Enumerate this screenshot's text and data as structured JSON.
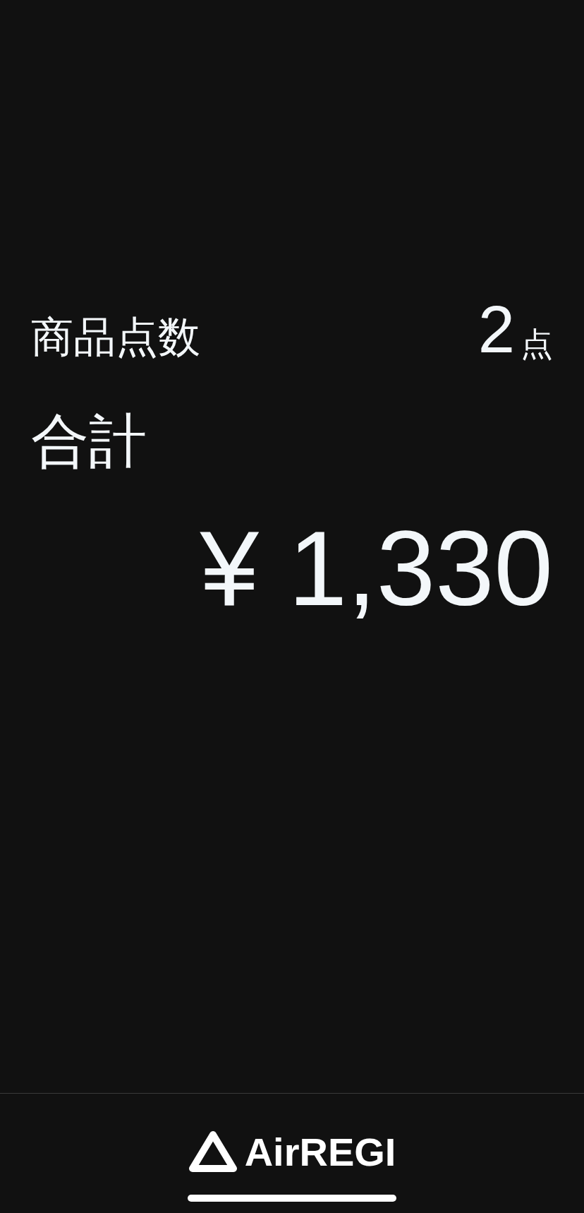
{
  "summary": {
    "item_count_label": "商品点数",
    "item_count_value": "2",
    "item_count_unit": "点",
    "total_label": "合計",
    "total_amount": "¥ 1,330"
  },
  "footer": {
    "logo_text": "AirREGI"
  }
}
